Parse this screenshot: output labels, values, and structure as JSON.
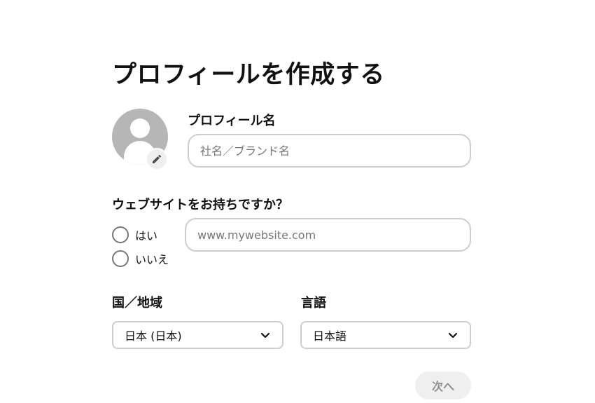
{
  "page": {
    "title": "プロフィールを作成する"
  },
  "profile": {
    "name_label": "プロフィール名",
    "name_placeholder": "社名／ブランド名",
    "avatar_icon": "default-avatar-icon",
    "edit_icon": "pencil-icon"
  },
  "website": {
    "question": "ウェブサイトをお持ちですか？",
    "options": [
      "はい",
      "いいえ"
    ],
    "url_placeholder": "www.mywebsite.com"
  },
  "region": {
    "label": "国／地域",
    "value": "日本 (日本)"
  },
  "language": {
    "label": "言語",
    "value": "日本語"
  },
  "actions": {
    "next_label": "次へ"
  },
  "colors": {
    "text": "#111111",
    "border": "#cdcdcd",
    "avatar": "#b6b6b6",
    "button_bg": "#efefef",
    "button_text_disabled": "#8e8e8e",
    "placeholder": "#767676"
  }
}
